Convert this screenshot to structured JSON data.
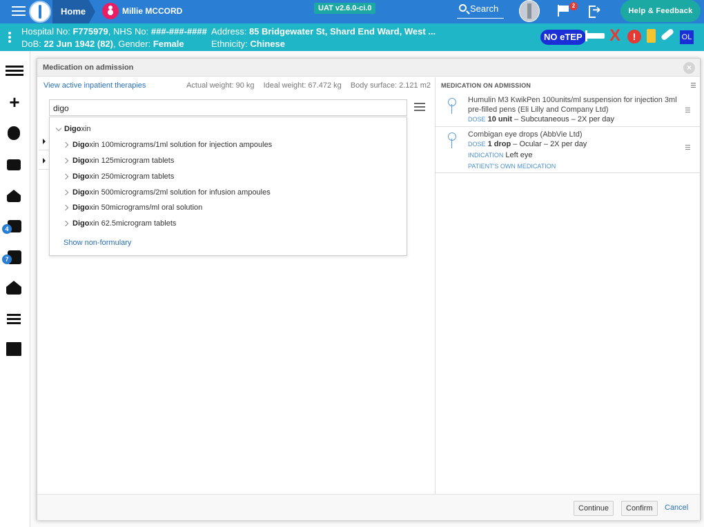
{
  "topbar": {
    "home_label": "Home",
    "patient_name": "Millie MCCORD",
    "version": "UAT v2.6.0-ci.0",
    "search_label": "Search",
    "notification_count": "2",
    "help_label": "Help & Feedback",
    "colors": {
      "bar": "#2a7fd4",
      "teal": "#1ca9a4"
    }
  },
  "banner": {
    "hospital_no_label": "Hospital No:",
    "hospital_no": "F775979",
    "nhs_no_label": ", NHS No:",
    "nhs_no": "###-###-####",
    "address_label": "Address:",
    "address": "85 Bridgewater St, Shard End Ward, West ...",
    "dob_label": "DoB:",
    "dob": "22 Jun 1942 (82)",
    "gender_label": ", Gender:",
    "gender": "Female",
    "ethnicity_label": "Ethnicity:",
    "ethnicity": "Chinese",
    "no_etep": "NO eTEP",
    "ol_badge": "OL",
    "alert_mark": "!",
    "x_mark": "X"
  },
  "nav": {
    "badges": [
      "4",
      "7"
    ],
    "icons": [
      "list-icon",
      "plus-icon",
      "stethoscope-icon",
      "camera-icon",
      "home-icon",
      "prescription-icon",
      "clipboard-icon",
      "discharge-icon",
      "checklist-icon",
      "calendar-icon"
    ]
  },
  "modal": {
    "title": "Medication on admission",
    "close": "×",
    "active_therapies_link": "View active inpatient therapies",
    "actual_weight": "Actual weight: 90 kg",
    "ideal_weight": "Ideal weight: 67.472 kg",
    "body_surface": "Body surface: 2.121 m2",
    "search_value": "digo",
    "dropdown": {
      "group": {
        "match": "Digo",
        "rest": "xin"
      },
      "items": [
        {
          "match": "Digo",
          "rest": "xin 100micrograms/1ml solution for injection ampoules"
        },
        {
          "match": "Digo",
          "rest": "xin 125microgram tablets"
        },
        {
          "match": "Digo",
          "rest": "xin 250microgram tablets"
        },
        {
          "match": "Digo",
          "rest": "xin 500micrograms/2ml solution for infusion ampoules"
        },
        {
          "match": "Digo",
          "rest": "xin 50micrograms/ml oral solution"
        },
        {
          "match": "Digo",
          "rest": "xin 62.5microgram tablets"
        }
      ],
      "show_non_formulary": "Show non-formulary"
    },
    "right_title": "MEDICATION ON ADMISSION",
    "meds": [
      {
        "name": "Humulin M3 KwikPen 100units/ml suspension for injection 3ml pre-filled pens (Eli Lilly and Company Ltd)",
        "dose_label": "DOSE",
        "dose": "10 unit",
        "detail": "– Subcutaneous – 2X per day"
      },
      {
        "name": "Combigan eye drops (AbbVie Ltd)",
        "dose_label": "DOSE",
        "dose": "1 drop",
        "detail": "– Ocular – 2X per day",
        "indication_label": "INDICATION",
        "indication": "Left eye",
        "tag": "PATIENT'S OWN MEDICATION"
      }
    ],
    "footer": {
      "continue": "Continue",
      "confirm": "Confirm",
      "cancel": "Cancel"
    }
  }
}
